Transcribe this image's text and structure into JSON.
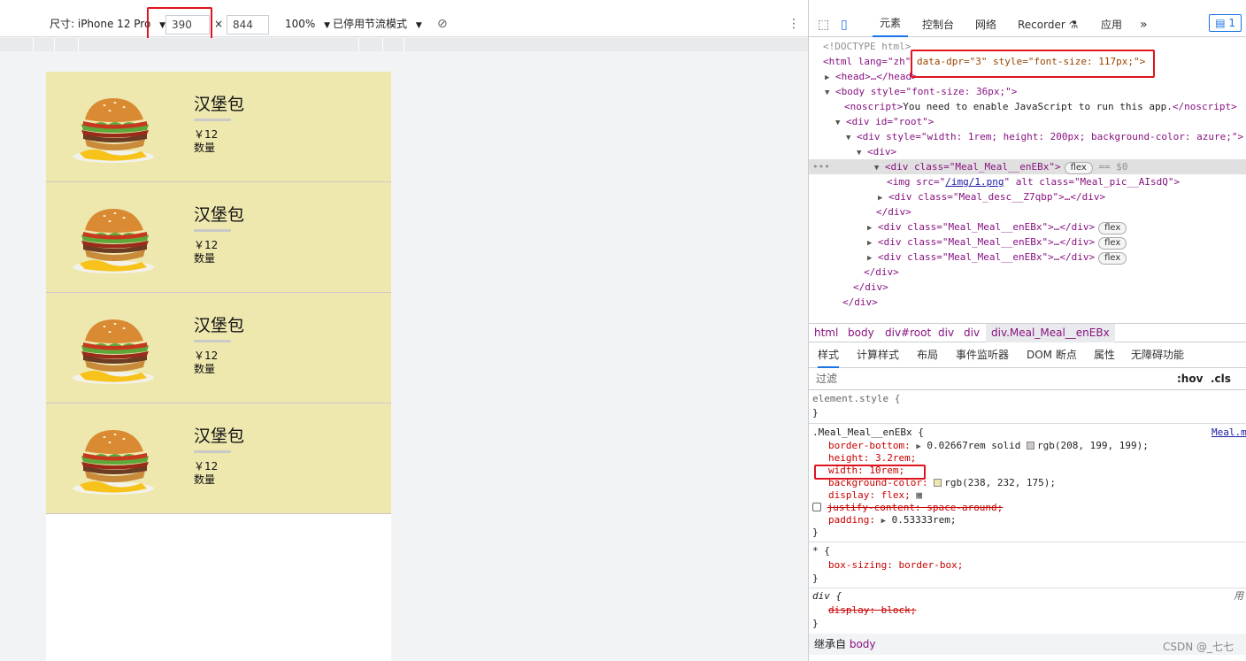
{
  "device_toolbar": {
    "size_label": "尺寸: iPhone 12 Pro",
    "width": "390",
    "times": "×",
    "height": "844",
    "zoom": "100%",
    "throttle": "已停用节流模式"
  },
  "meals": [
    {
      "name": "汉堡包",
      "price": "￥12",
      "count_label": "数量"
    },
    {
      "name": "汉堡包",
      "price": "￥12",
      "count_label": "数量"
    },
    {
      "name": "汉堡包",
      "price": "￥12",
      "count_label": "数量"
    },
    {
      "name": "汉堡包",
      "price": "￥12",
      "count_label": "数量"
    }
  ],
  "devtools": {
    "tabs": [
      "元素",
      "控制台",
      "网络",
      "Recorder",
      "应用"
    ],
    "issues_count": "1",
    "dom": {
      "doctype": "<!DOCTYPE html>",
      "html_open": "<html lang=\"zh\"",
      "html_attrs": "data-dpr=\"3\" style=\"font-size: 117px;\">",
      "head": "<head>…</head>",
      "body": "<body style=\"font-size: 36px;\">",
      "noscript_tag": "<noscript>",
      "noscript_text": "You need to enable JavaScript to run this app.",
      "noscript_close": "</noscript>",
      "root": "<div id=\"root\">",
      "styled_div": "<div style=\"width: 1rem; height: 200px; background-color: azure;\">",
      "div": "<div>",
      "meal_div": "<div class=\"Meal_Meal__enEBx\">",
      "flex": "flex",
      "eq": "== $0",
      "img_pre": "<img src=\"",
      "img_src": "/img/1.png",
      "img_post": "\" alt class=\"Meal_pic__AIsdQ\">",
      "desc_div": "<div class=\"Meal_desc__Z7qbp\">…</div>",
      "close_div": "</div>",
      "meal_div_collapsed": "<div class=\"Meal_Meal__enEBx\">…</div>"
    },
    "breadcrumbs": [
      "html",
      "body",
      "div#root",
      "div",
      "div",
      "div.Meal_Meal__enEBx"
    ],
    "style_tabs": [
      "样式",
      "计算样式",
      "布局",
      "事件监听器",
      "DOM 断点",
      "属性",
      "无障碍功能"
    ],
    "filter_placeholder": "过滤",
    "hov": ":hov",
    "cls": ".cls",
    "styles": {
      "element_style": "element.style {",
      "close_brace": "}",
      "meal_selector": ".Meal_Meal__enEBx {",
      "meal_source": "Meal.m",
      "border_bottom_prop": "border-bottom:",
      "border_bottom_val": "0.02667rem solid",
      "border_color": "rgb(208, 199, 199);",
      "height": "height: 3.2rem;",
      "width": "width: 10rem;",
      "bg_prop": "background-color:",
      "bg_val": "rgb(238, 232, 175);",
      "display": "display: flex;",
      "justify": "justify-content: space-around;",
      "padding_prop": "padding:",
      "padding_val": "0.53333rem;",
      "star_selector": "* {",
      "box_sizing": "box-sizing: border-box;",
      "div_selector": "div {",
      "div_source": "用",
      "display_block": "display: block;",
      "inherit_label": "继承自",
      "inherit_from": "body"
    },
    "colors": {
      "swatch_border": "#d0c7c7",
      "swatch_bg": "#eee8af"
    }
  },
  "watermark": "CSDN @_七七"
}
